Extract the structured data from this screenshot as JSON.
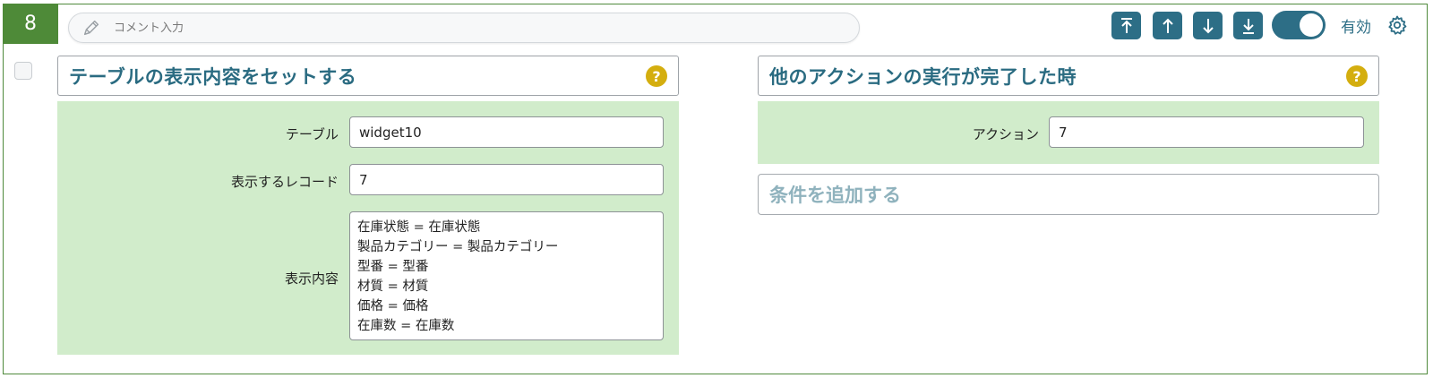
{
  "step": {
    "number": "8"
  },
  "comment": {
    "placeholder": "コメント入力",
    "value": ""
  },
  "toolbar": {
    "buttons": [
      {
        "icon": "move-top-icon"
      },
      {
        "icon": "move-up-icon"
      },
      {
        "icon": "move-down-icon"
      },
      {
        "icon": "move-bottom-icon"
      }
    ],
    "toggle_on": true,
    "enabled_label": "有効",
    "settings_icon": "gear-icon"
  },
  "action_panel": {
    "title": "テーブルの表示内容をセットする",
    "help": "?",
    "fields": {
      "table_label": "テーブル",
      "table_value": "widget10",
      "record_label": "表示するレコード",
      "record_value": "7",
      "content_label": "表示内容",
      "content_lines": [
        "在庫状態 = 在庫状態",
        "製品カテゴリー = 製品カテゴリー",
        "型番 = 型番",
        "材質 = 材質",
        "価格 = 価格",
        "在庫数 = 在庫数"
      ]
    }
  },
  "trigger_panel": {
    "title": "他のアクションの実行が完了した時",
    "help": "?",
    "action_label": "アクション",
    "action_value": "7",
    "add_condition": "条件を追加する"
  },
  "colors": {
    "accent": "#2d6e86",
    "step_badge": "#4e8a38",
    "green_bg": "#d1eccb",
    "help": "#d4ae0f"
  }
}
